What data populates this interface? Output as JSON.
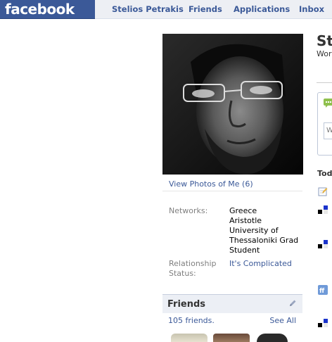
{
  "brand": {
    "logo_text": "facebook"
  },
  "nav": {
    "items": [
      {
        "label": "Stelios Petrakis"
      },
      {
        "label": "Friends"
      },
      {
        "label": "Applications"
      },
      {
        "label": "Inbox"
      }
    ]
  },
  "profile": {
    "name_fragment": "Ste",
    "sub_fragment": "Wor",
    "view_photos_label": "View Photos of Me (6)",
    "info": {
      "networks_label": "Networks:",
      "networks_value_lines": [
        "Greece",
        "Aristotle",
        "University of",
        "Thessaloniki Grad",
        "Student"
      ],
      "relationship_label_lines": [
        "Relationship",
        "Status:"
      ],
      "relationship_value": "It's Complicated"
    }
  },
  "friends": {
    "title": "Friends",
    "count_label": "105 friends.",
    "see_all_label": "See All"
  },
  "publisher": {
    "input_fragment": "W"
  },
  "feed": {
    "today_fragment": "Toda"
  },
  "colors": {
    "brand_blue": "#3b5998",
    "nav_bg": "#edeff4",
    "box_header_bg": "#eceff5"
  }
}
